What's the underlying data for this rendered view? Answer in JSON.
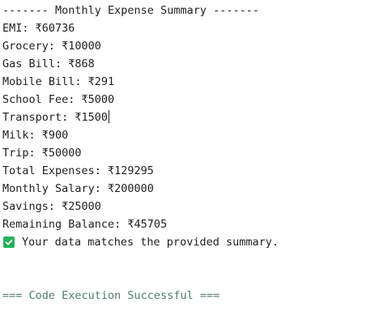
{
  "colors": {
    "text": "#1f1f1f",
    "check_bg": "#22b259",
    "check_mark": "#ffffff",
    "success_text": "#4e7d6b"
  },
  "output": {
    "header": "------- Monthly Expense Summary -------",
    "lines": [
      "EMI: ₹60736",
      "Grocery: ₹10000",
      "Gas Bill: ₹868",
      "Mobile Bill: ₹291",
      "School Fee: ₹5000",
      "Transport: ₹1500",
      "Milk: ₹900",
      "Trip: ₹50000",
      "Total Expenses: ₹129295",
      "Monthly Salary: ₹200000",
      "Savings: ₹25000",
      "Remaining Balance: ₹45705"
    ],
    "check_icon": "check-box-icon",
    "check_message": "Your data matches the provided summary.",
    "status": "=== Code Execution Successful ==="
  }
}
